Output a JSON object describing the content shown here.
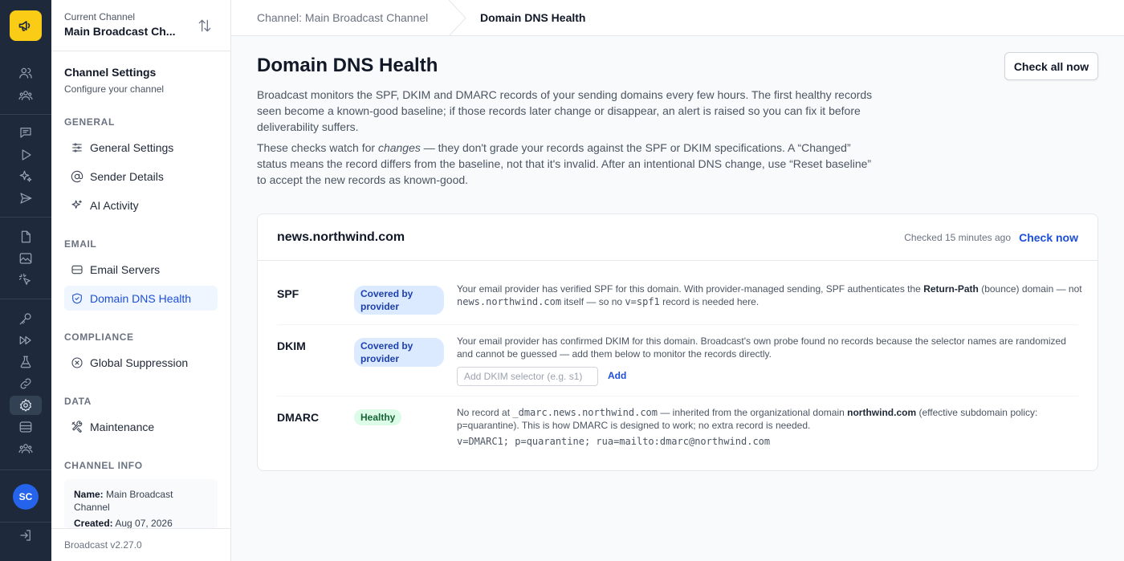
{
  "channel": {
    "current_label": "Current Channel",
    "current_name": "Main Broadcast Ch..."
  },
  "sidebar": {
    "title": "Channel Settings",
    "subtitle": "Configure your channel",
    "sections": {
      "general": "GENERAL",
      "email": "EMAIL",
      "compliance": "COMPLIANCE",
      "data": "DATA",
      "channel_info": "CHANNEL INFO"
    },
    "items": {
      "general_settings": "General Settings",
      "sender_details": "Sender Details",
      "ai_activity": "AI Activity",
      "email_servers": "Email Servers",
      "domain_dns_health": "Domain DNS Health",
      "global_suppression": "Global Suppression",
      "maintenance": "Maintenance"
    },
    "info": {
      "name_label": "Name:",
      "name_value": "Main Broadcast Channel",
      "created_label": "Created:",
      "created_value": "Aug 07, 2026"
    },
    "version": "Broadcast v2.27.0"
  },
  "user": {
    "initials": "SC"
  },
  "breadcrumb": {
    "parent": "Channel: Main Broadcast Channel",
    "current": "Domain DNS Health"
  },
  "page": {
    "title": "Domain DNS Health",
    "check_all_label": "Check all now",
    "intro1": "Broadcast monitors the SPF, DKIM and DMARC records of your sending domains every few hours. The first healthy records seen become a known-good baseline; if those records later change or disappear, an alert is raised so you can fix it before deliverability suffers.",
    "intro2_a": "These checks watch for ",
    "intro2_em": "changes",
    "intro2_b": " — they don't grade your records against the SPF or DKIM specifications. A “Changed” status means the record differs from the baseline, not that it's invalid. After an intentional DNS change, use “Reset baseline” to accept the new records as known-good."
  },
  "domain_card": {
    "domain": "news.northwind.com",
    "checked": "Checked 15 minutes ago",
    "check_now": "Check now",
    "spf": {
      "label": "SPF",
      "status": "Covered by provider",
      "t1": "Your email provider has verified SPF for this domain. With provider-managed sending, SPF authenticates the ",
      "b1": "Return-Path",
      "t2": " (bounce) domain — not ",
      "c1": "news.northwind.com",
      "t3": " itself — so no ",
      "c2": "v=spf1",
      "t4": " record is needed here."
    },
    "dkim": {
      "label": "DKIM",
      "status": "Covered by provider",
      "text": "Your email provider has confirmed DKIM for this domain. Broadcast's own probe found no records because the selector names are randomized and cannot be guessed — add them below to monitor the records directly.",
      "selector_placeholder": "Add DKIM selector (e.g. s1)",
      "add_label": "Add"
    },
    "dmarc": {
      "label": "DMARC",
      "status": "Healthy",
      "t1": "No record at ",
      "c1": "_dmarc.news.northwind.com",
      "t2": " — inherited from the organizational domain ",
      "b1": "northwind.com",
      "t3": " (effective subdomain policy: p=quarantine). This is how DMARC is designed to work; no extra record is needed.",
      "record": "v=DMARC1; p=quarantine; rua=mailto:dmarc@northwind.com"
    }
  },
  "colors": {
    "rail_bg": "#1e293b",
    "brand_yellow": "#facc15",
    "accent_blue": "#1d4ed8",
    "badge_blue_bg": "#dbeafe",
    "badge_green_bg": "#dcfce7"
  },
  "icons": {
    "logo": "megaphone-icon",
    "rail": [
      "users-icon",
      "group-icon",
      "chat-icon",
      "play-icon",
      "sparkles-icon",
      "send-icon",
      "document-icon",
      "image-icon",
      "cursor-click-icon",
      "key-icon",
      "fast-forward-icon",
      "flask-icon",
      "link-icon",
      "gear-icon",
      "database-icon",
      "group-icon",
      "logout-icon"
    ]
  }
}
